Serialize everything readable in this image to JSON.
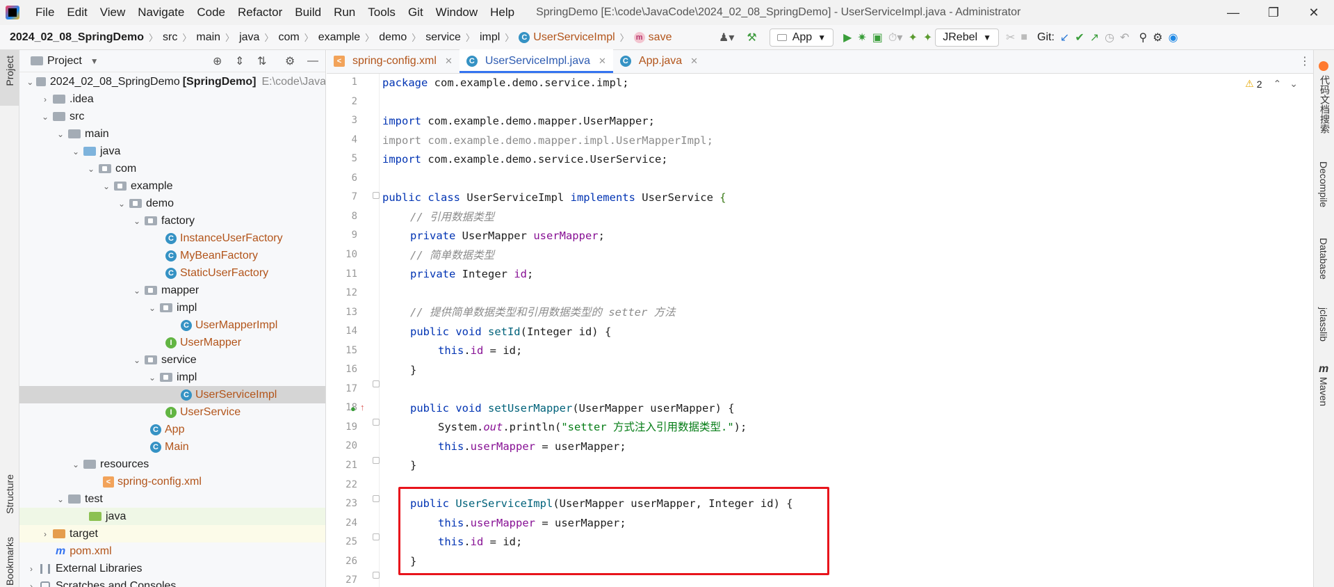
{
  "titlebar": {
    "menu": [
      "File",
      "Edit",
      "View",
      "Navigate",
      "Code",
      "Refactor",
      "Build",
      "Run",
      "Tools",
      "Git",
      "Window",
      "Help"
    ],
    "window_title": "SpringDemo [E:\\code\\JavaCode\\2024_02_08_SpringDemo] - UserServiceImpl.java - Administrator"
  },
  "navbar": {
    "crumbs": [
      "2024_02_08_SpringDemo",
      "src",
      "main",
      "java",
      "com",
      "example",
      "demo",
      "service",
      "impl"
    ],
    "class_crumb": "UserServiceImpl",
    "method_crumb": "save",
    "run_config": "App",
    "jrebel": "JRebel",
    "git_label": "Git:"
  },
  "project": {
    "header": "Project",
    "root_name": "2024_02_08_SpringDemo",
    "root_module": "[SpringDemo]",
    "root_path": "E:\\code\\Java",
    "tree": [
      {
        "label": ".idea"
      },
      {
        "label": "src"
      },
      {
        "label": "main"
      },
      {
        "label": "java"
      },
      {
        "label": "com"
      },
      {
        "label": "example"
      },
      {
        "label": "demo"
      },
      {
        "label": "factory"
      },
      {
        "label": "InstanceUserFactory"
      },
      {
        "label": "MyBeanFactory"
      },
      {
        "label": "StaticUserFactory"
      },
      {
        "label": "mapper"
      },
      {
        "label": "impl"
      },
      {
        "label": "UserMapperImpl"
      },
      {
        "label": "UserMapper"
      },
      {
        "label": "service"
      },
      {
        "label": "impl"
      },
      {
        "label": "UserServiceImpl"
      },
      {
        "label": "UserService"
      },
      {
        "label": "App"
      },
      {
        "label": "Main"
      },
      {
        "label": "resources"
      },
      {
        "label": "spring-config.xml"
      },
      {
        "label": "test"
      },
      {
        "label": "java"
      },
      {
        "label": "target"
      },
      {
        "label": "pom.xml"
      },
      {
        "label": "External Libraries"
      },
      {
        "label": "Scratches and Consoles"
      }
    ]
  },
  "left_strip": {
    "project": "Project",
    "structure": "Structure",
    "bookmarks": "Bookmarks"
  },
  "right_strip": {
    "doc_search": "代码文档搜索",
    "decompile": "Decompile",
    "database": "Database",
    "jclasslib": "jclasslib",
    "maven": "Maven"
  },
  "tabs": [
    {
      "label": "spring-config.xml"
    },
    {
      "label": "UserServiceImpl.java"
    },
    {
      "label": "App.java"
    }
  ],
  "warnings": "2",
  "code": {
    "line_numbers": [
      "1",
      "2",
      "3",
      "4",
      "5",
      "6",
      "7",
      "8",
      "9",
      "10",
      "11",
      "12",
      "13",
      "14",
      "15",
      "16",
      "17",
      "18",
      "19",
      "20",
      "21",
      "22",
      "23",
      "24",
      "25",
      "26",
      "27"
    ],
    "l1": [
      "package",
      " com.example.demo.service.impl;"
    ],
    "l3": [
      "import",
      " com.example.demo.mapper.UserMapper;"
    ],
    "l4": "import com.example.demo.mapper.impl.UserMapperImpl;",
    "l5": [
      "import",
      " com.example.demo.service.UserService;"
    ],
    "l7": [
      "public class ",
      "UserServiceImpl ",
      "implements ",
      "UserService ",
      "{"
    ],
    "l8": "// 引用数据类型",
    "l9": [
      "private ",
      "UserMapper ",
      "userMapper",
      ";"
    ],
    "l10": "// 简单数据类型",
    "l11": [
      "private ",
      "Integer ",
      "id",
      ";"
    ],
    "l13": "// 提供简单数据类型和引用数据类型的 setter 方法",
    "l14": [
      "public void ",
      "setId",
      "(Integer id) {"
    ],
    "l15": [
      "this",
      ".",
      "id",
      " = id;"
    ],
    "l16": "}",
    "l18": [
      "public void ",
      "setUserMapper",
      "(UserMapper userMapper) {"
    ],
    "l19": [
      "System.",
      "out",
      ".println(",
      "\"setter 方式注入引用数据类型.\"",
      ");"
    ],
    "l20": [
      "this",
      ".",
      "userMapper",
      " = userMapper;"
    ],
    "l21": "}",
    "l23": [
      "public ",
      "UserServiceImpl",
      "(UserMapper userMapper, Integer id) {"
    ],
    "l24": [
      "this",
      ".",
      "userMapper",
      " = userMapper;"
    ],
    "l25": [
      "this",
      ".",
      "id",
      " = id;"
    ],
    "l26": "}"
  }
}
